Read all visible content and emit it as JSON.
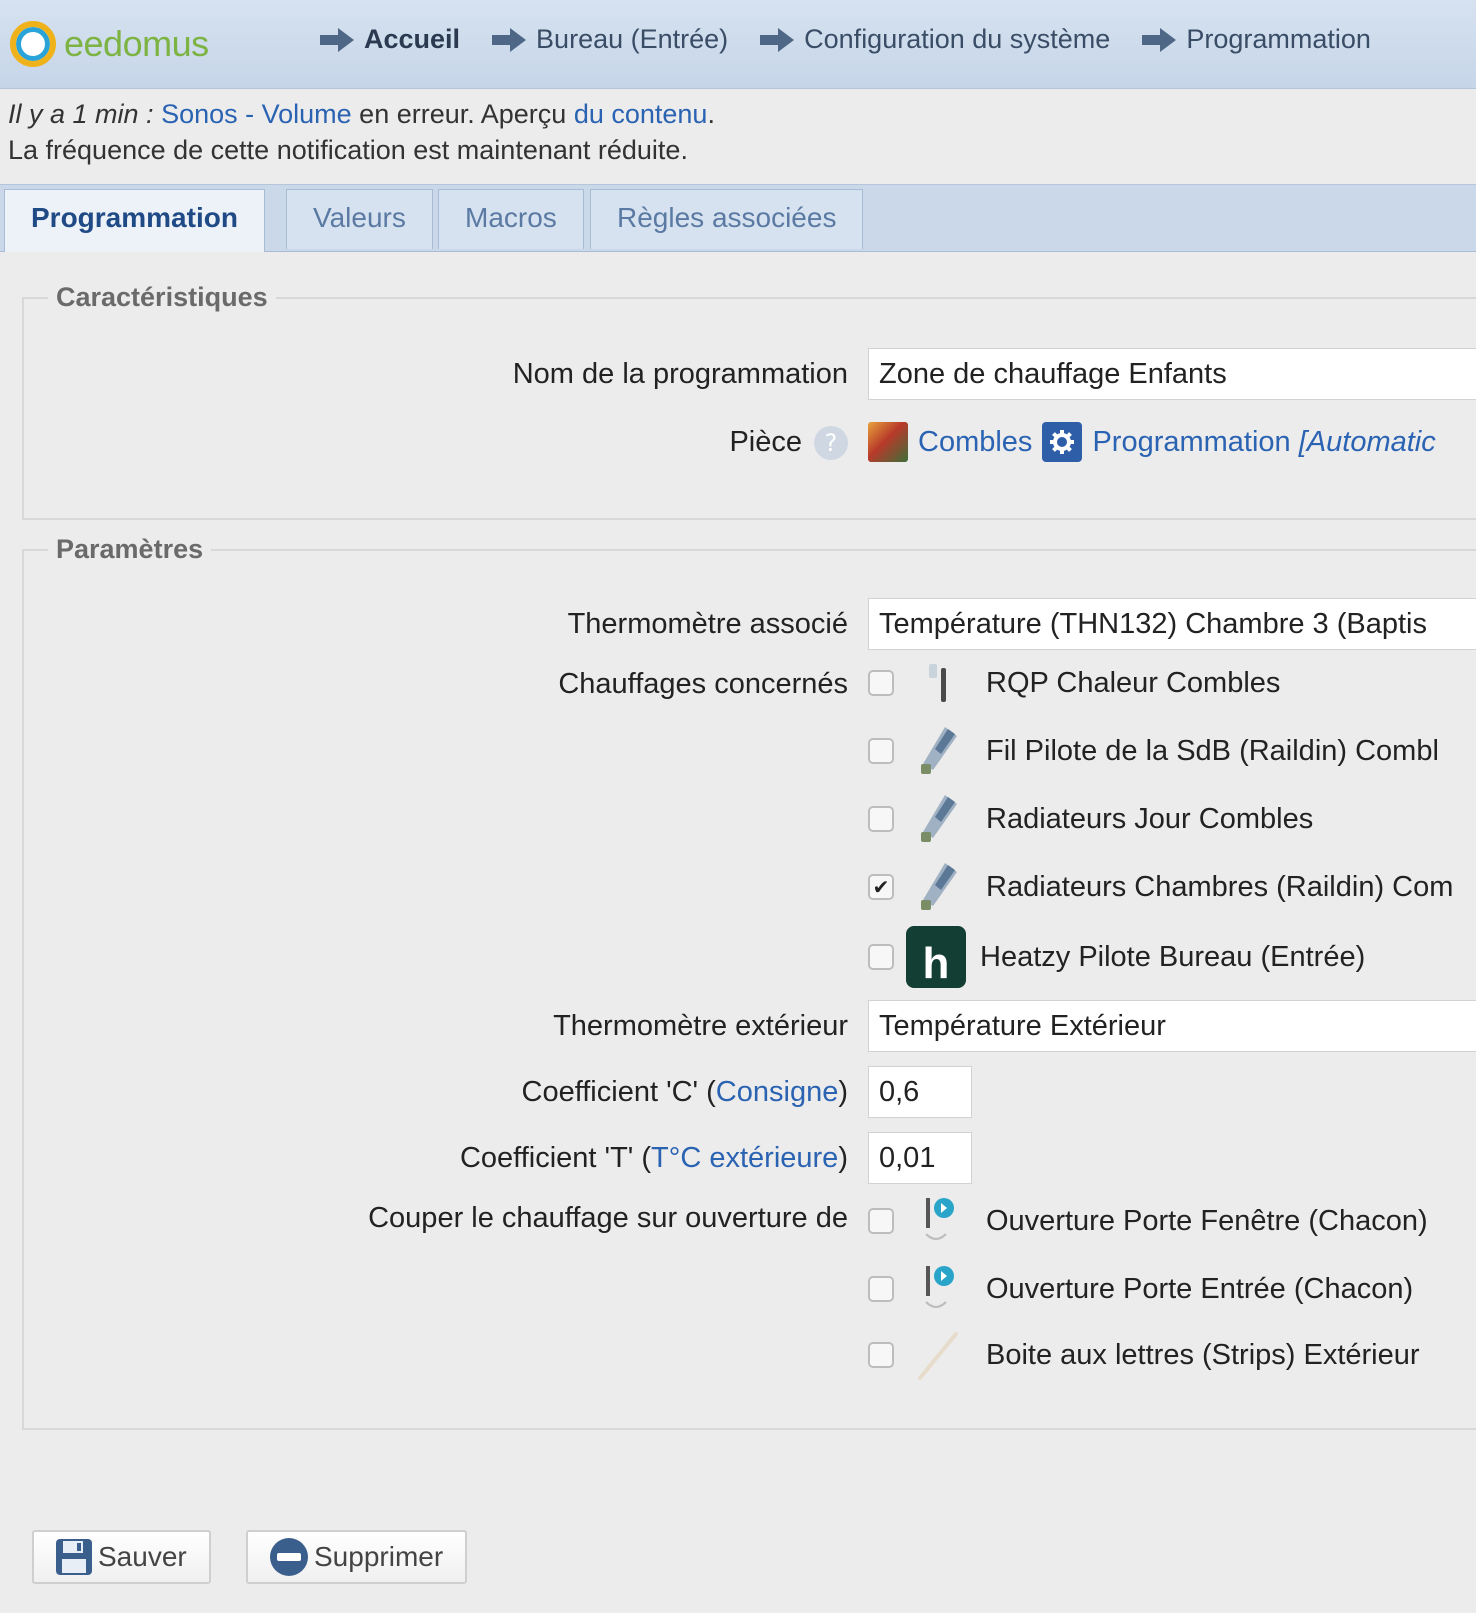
{
  "brand": {
    "name": "eedomus"
  },
  "breadcrumb": [
    {
      "label": "Accueil"
    },
    {
      "label": "Bureau (Entrée)"
    },
    {
      "label": "Configuration du système"
    },
    {
      "label": "Programmation"
    }
  ],
  "notification": {
    "ago": "Il y a 1 min :",
    "device": "Sonos - Volume",
    "status": " en erreur. Aperçu ",
    "link": "du contenu",
    "end": ".",
    "line2": "La fréquence de cette notification est maintenant réduite."
  },
  "tabs": [
    {
      "label": "Programmation",
      "active": true
    },
    {
      "label": "Valeurs"
    },
    {
      "label": "Macros"
    },
    {
      "label": "Règles associées"
    }
  ],
  "caracteristiques": {
    "legend": "Caractéristiques",
    "name_label": "Nom de la programmation",
    "name_value": "Zone de chauffage Enfants",
    "room_label": "Pièce",
    "room_help": "?",
    "room_value": "Combles",
    "room_type": "Programmation",
    "room_type_extra": "[Automatic"
  },
  "parametres": {
    "legend": "Paramètres",
    "thermo_label": "Thermomètre associé",
    "thermo_value": "Température (THN132) Chambre 3 (Baptis",
    "heaters_label": "Chauffages concernés",
    "heaters": [
      {
        "label": "RQP Chaleur Combles",
        "checked": false,
        "icon": "relay-switch-icon"
      },
      {
        "label": "Fil Pilote de la SdB (Raildin) Combl",
        "checked": false,
        "icon": "fil-pilote-icon"
      },
      {
        "label": "Radiateurs Jour Combles",
        "checked": false,
        "icon": "fil-pilote-icon"
      },
      {
        "label": "Radiateurs Chambres (Raildin) Com",
        "checked": true,
        "icon": "fil-pilote-icon"
      },
      {
        "label": "Heatzy Pilote Bureau (Entrée)",
        "checked": false,
        "icon": "heatzy-logo-icon",
        "icon_letter": "h"
      }
    ],
    "ext_thermo_label": "Thermomètre extérieur",
    "ext_thermo_value": "Température Extérieur",
    "coef_c_label_pre": "Coefficient 'C' (",
    "coef_c_link": "Consigne",
    "coef_c_label_post": ")",
    "coef_c_value": "0,6",
    "coef_t_label_pre": "Coefficient 'T' (",
    "coef_t_link": "T°C extérieure",
    "coef_t_label_post": ")",
    "coef_t_value": "0,01",
    "cut_label": "Couper le chauffage sur ouverture de",
    "openings": [
      {
        "label": "Ouverture Porte Fenêtre (Chacon)",
        "checked": false,
        "icon": "door-sensor-icon"
      },
      {
        "label": "Ouverture Porte Entrée (Chacon)",
        "checked": false,
        "icon": "door-sensor-icon"
      },
      {
        "label": "Boite aux lettres (Strips) Extérieur",
        "checked": false,
        "icon": "strips-sensor-icon"
      }
    ]
  },
  "actions": {
    "save": "Sauver",
    "delete": "Supprimer"
  },
  "colors": {
    "link": "#2b63b3",
    "tab_active": "#1f4a86",
    "logo_green": "#7cb342",
    "heatzy": "#123e33"
  }
}
